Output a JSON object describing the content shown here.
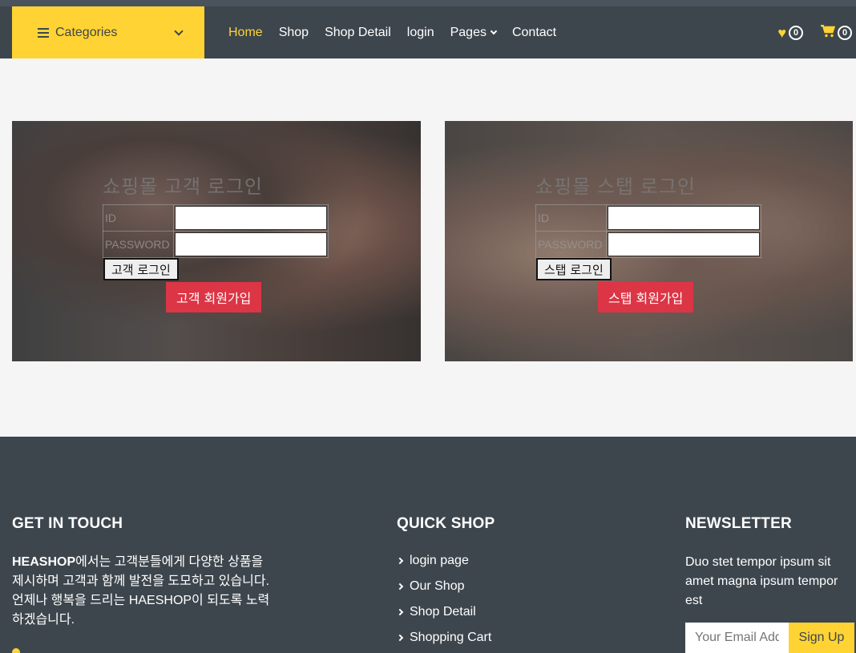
{
  "navbar": {
    "categories_label": "Categories",
    "links": [
      {
        "label": "Home",
        "active": true
      },
      {
        "label": "Shop"
      },
      {
        "label": "Shop Detail"
      },
      {
        "label": "login"
      },
      {
        "label": "Pages",
        "dropdown": true
      },
      {
        "label": "Contact"
      }
    ],
    "wishlist_count": "0",
    "cart_count": "0"
  },
  "customer_login": {
    "title": "쇼핑몰 고객 로그인",
    "id_label": "ID",
    "password_label": "PASSWORD",
    "login_button": "고객 로그인",
    "signup_button": "고객 회원가입"
  },
  "staff_login": {
    "title": "쇼핑몰 스탭 로그인",
    "id_label": "ID",
    "password_label": "PASSWORD",
    "login_button": "스탭 로그인",
    "signup_button": "스탭 회원가입"
  },
  "footer": {
    "get_in_touch": {
      "heading": "GET IN TOUCH",
      "brand": "HEASHOP",
      "text": "에서는 고객분들에게 다양한 상품을 제시하며 고객과 함께 발전을 도모하고 있습니다. 언제나 행복을 드리는 HAESHOP이 되도록 노력하겠습니다."
    },
    "quick_shop": {
      "heading": "QUICK SHOP",
      "items": [
        "login page",
        "Our Shop",
        "Shop Detail",
        "Shopping Cart"
      ]
    },
    "newsletter": {
      "heading": "NEWSLETTER",
      "text": "Duo stet tempor ipsum sit amet magna ipsum tempor est",
      "email_placeholder": "Your Email Address",
      "signup_button": "Sign Up"
    }
  },
  "colors": {
    "accent": "#ffd333",
    "dark": "#3d464d",
    "danger": "#dc3545"
  }
}
